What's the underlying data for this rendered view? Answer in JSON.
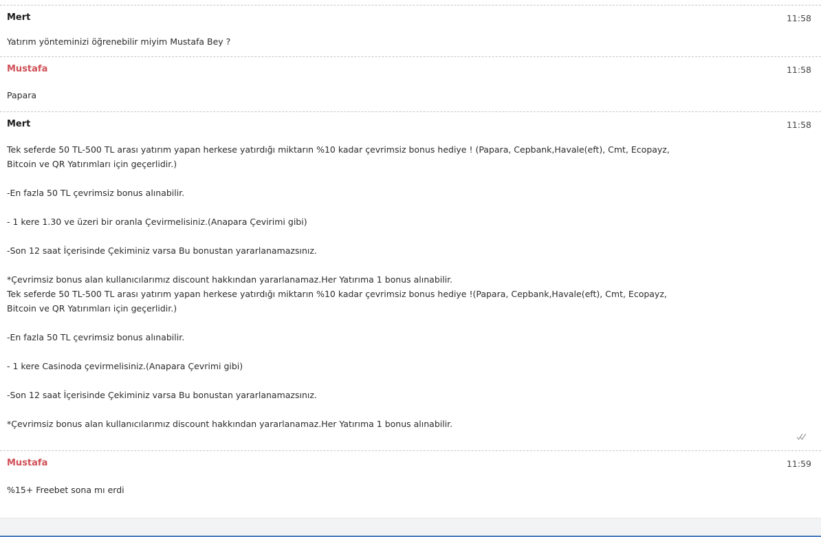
{
  "messages": [
    {
      "sender": "Mert",
      "time": "11:58",
      "lines": [
        "Yatırım yönteminizi öğrenebilir miyim Mustafa Bey ?"
      ]
    },
    {
      "sender": "Mustafa",
      "time": "11:58",
      "lines": [
        "Papara"
      ]
    },
    {
      "sender": "Mert",
      "time": "11:58",
      "lines": [
        "Tek seferde 50 TL-500 TL arası yatırım yapan herkese yatırdığı miktarın %10 kadar çevrimsiz bonus hediye ! (Papara, Cepbank,Havale(eft), Cmt, Ecopayz,",
        "Bitcoin ve QR Yatırımları için geçerlidir.)",
        "",
        "-En fazla 50 TL çevrimsiz bonus alınabilir.",
        "",
        "- 1 kere 1.30 ve üzeri bir oranla Çevirmelisiniz.(Anapara Çevirimi gibi)",
        "",
        "-Son 12 saat İçerisinde Çekiminiz varsa Bu bonustan yararlanamazsınız.",
        "",
        "*Çevrimsiz bonus alan kullanıcılarımız discount hakkından yararlanamaz.Her Yatırıma 1 bonus alınabilir.",
        "Tek seferde 50 TL-500 TL arası yatırım yapan herkese yatırdığı miktarın %10 kadar çevrimsiz bonus hediye !(Papara, Cepbank,Havale(eft), Cmt, Ecopayz,",
        "Bitcoin ve QR Yatırımları için geçerlidir.)",
        "",
        "-En fazla 50 TL çevrimsiz bonus alınabilir.",
        "",
        "- 1 kere Casinoda çevirmelisiniz.(Anapara Çevrimi gibi)",
        "",
        "-Son 12 saat İçerisinde Çekiminiz varsa Bu bonustan yararlanamazsınız.",
        "",
        "*Çevrimsiz bonus alan kullanıcılarımız discount hakkından yararlanamaz.Her Yatırıma 1 bonus alınabilir."
      ],
      "status_icon": "double-check-icon"
    },
    {
      "sender": "Mustafa",
      "time": "11:59",
      "lines": [
        "%15+ Freebet sona mı erdi"
      ]
    }
  ],
  "colors": {
    "agent_name": "#cf4f55",
    "user_name": "#1a1a1a",
    "divider": "#c6c6c6",
    "footer_accent": "#4a7dc0"
  }
}
